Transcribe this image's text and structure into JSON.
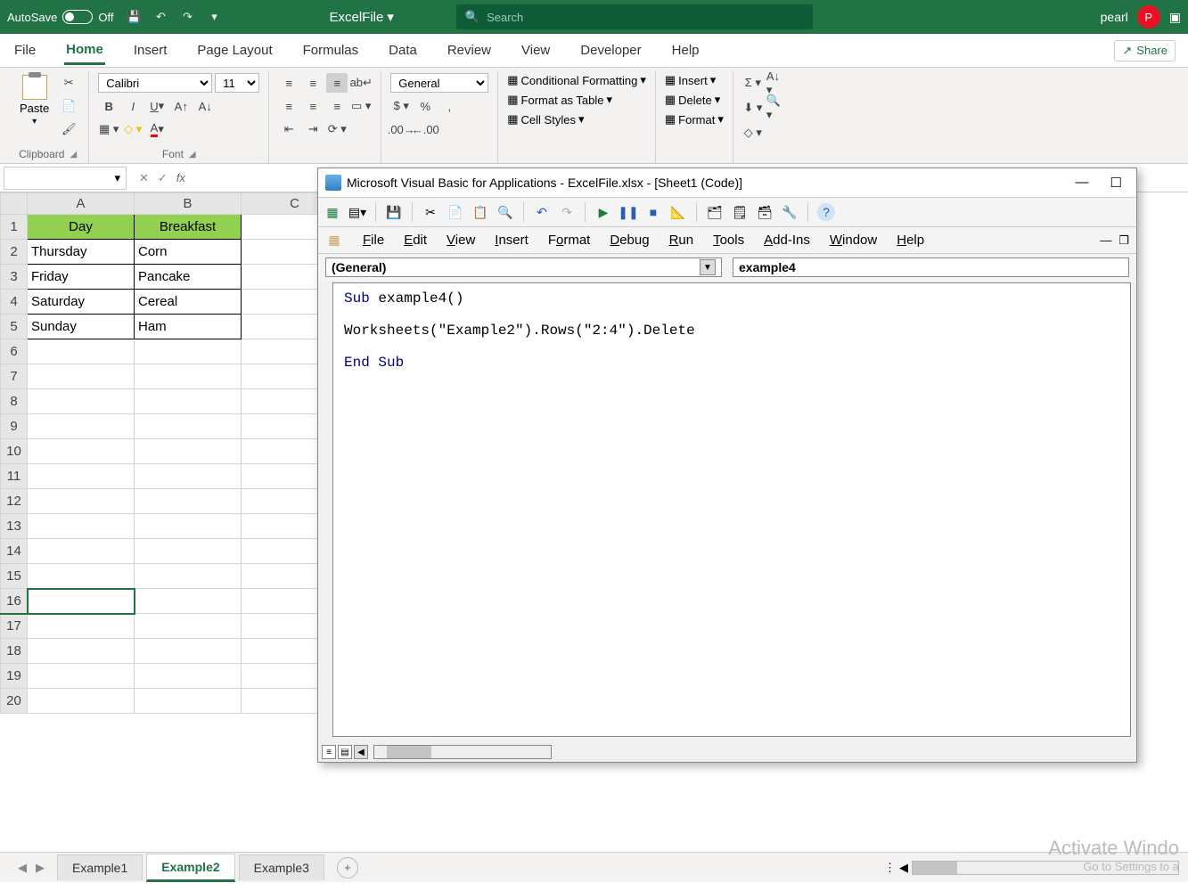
{
  "titleBar": {
    "autosave": "AutoSave",
    "autosaveState": "Off",
    "fileName": "ExcelFile",
    "searchPlaceholder": "Search",
    "userName": "pearl",
    "userInitial": "P"
  },
  "ribbonTabs": [
    "File",
    "Home",
    "Insert",
    "Page Layout",
    "Formulas",
    "Data",
    "Review",
    "View",
    "Developer",
    "Help"
  ],
  "activeRibbonTab": "Home",
  "shareLabel": "Share",
  "ribbon": {
    "clipboard": {
      "paste": "Paste",
      "label": "Clipboard"
    },
    "font": {
      "name": "Calibri",
      "size": "11",
      "label": "Font"
    },
    "number": {
      "format": "General"
    },
    "styles": {
      "condFmt": "Conditional Formatting",
      "asTable": "Format as Table",
      "cellStyles": "Cell Styles"
    },
    "cells": {
      "insert": "Insert",
      "delete": "Delete",
      "format": "Format"
    }
  },
  "nameBox": "",
  "grid": {
    "columns": [
      "A",
      "B",
      "C"
    ],
    "rowCount": 20,
    "headers": [
      "Day",
      "Breakfast"
    ],
    "data": [
      [
        "Thursday",
        "Corn"
      ],
      [
        "Friday",
        "Pancake"
      ],
      [
        "Saturday",
        "Cereal"
      ],
      [
        "Sunday",
        "Ham"
      ]
    ],
    "selectedRow": 16
  },
  "sheetTabs": [
    "Example1",
    "Example2",
    "Example3"
  ],
  "activeSheet": "Example2",
  "watermark": {
    "l1": "Activate Windo",
    "l2": "Go to Settings to a"
  },
  "vba": {
    "title": "Microsoft Visual Basic for Applications - ExcelFile.xlsx - [Sheet1 (Code)]",
    "menus": [
      "File",
      "Edit",
      "View",
      "Insert",
      "Format",
      "Debug",
      "Run",
      "Tools",
      "Add-Ins",
      "Window",
      "Help"
    ],
    "ddLeft": "(General)",
    "ddRight": "example4",
    "code": {
      "l1a": "Sub ",
      "l1b": "example4()",
      "l2": "Worksheets(\"Example2\").Rows(\"2:4\").Delete",
      "l3": "End Sub"
    }
  }
}
